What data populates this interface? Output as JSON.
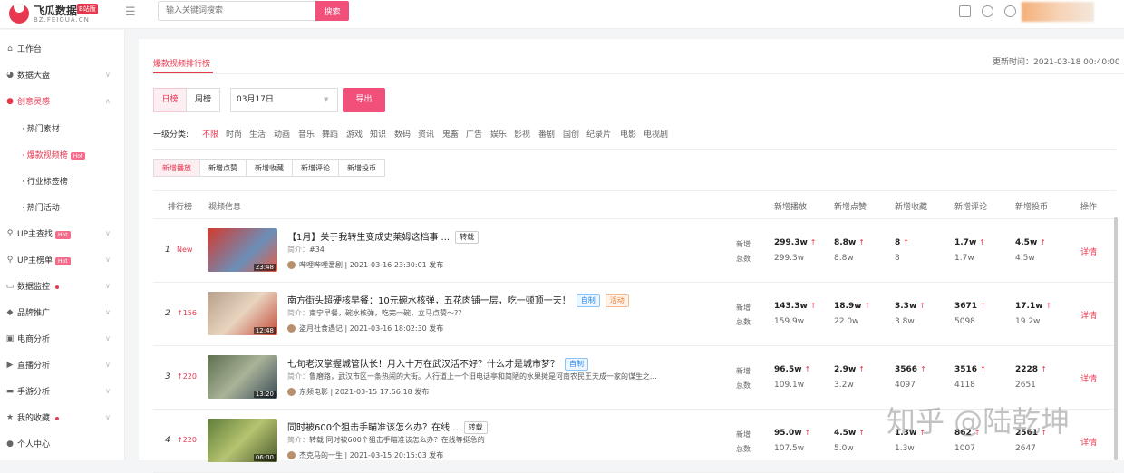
{
  "topbar": {
    "logo_name": "飞瓜数据",
    "logo_badge": "B站版",
    "logo_domain": "BZ.FEIGUA.CN",
    "search_placeholder": "输入关键词搜索",
    "search_button": "搜索"
  },
  "sidebar": {
    "items": [
      {
        "label": "工作台",
        "icon": "home-icon"
      },
      {
        "label": "数据大盘",
        "icon": "pie-chart-icon"
      },
      {
        "label": "创意灵感",
        "icon": "bulb-icon"
      },
      {
        "label": "UP主查找",
        "icon": "search-icon",
        "badge": "Hot"
      },
      {
        "label": "UP主榜单",
        "icon": "search-icon",
        "badge": "Hot"
      },
      {
        "label": "数据监控",
        "icon": "monitor-icon"
      },
      {
        "label": "品牌推广",
        "icon": "diamond-icon"
      },
      {
        "label": "电商分析",
        "icon": "shop-icon"
      },
      {
        "label": "直播分析",
        "icon": "live-icon"
      },
      {
        "label": "手游分析",
        "icon": "gamepad-icon"
      },
      {
        "label": "我的收藏",
        "icon": "star-icon"
      },
      {
        "label": "个人中心",
        "icon": "user-icon"
      }
    ],
    "sub_items": [
      {
        "label": "· 热门素材"
      },
      {
        "label": "· 爆款视频榜",
        "badge": "Hot"
      },
      {
        "label": "· 行业标签榜"
      },
      {
        "label": "· 热门活动"
      }
    ]
  },
  "main": {
    "tab": "爆款视频排行榜",
    "update_time": "更新时间：2021-03-18 00:40:00",
    "period": [
      "日榜",
      "周榜"
    ],
    "date": "03月17日",
    "export": "导出",
    "category_label": "一级分类:",
    "categories": [
      "不限",
      "时尚",
      "生活",
      "动画",
      "音乐",
      "舞蹈",
      "游戏",
      "知识",
      "数码",
      "资讯",
      "鬼畜",
      "广告",
      "娱乐",
      "影视",
      "番剧",
      "国创",
      "纪录片",
      "电影",
      "电视剧"
    ],
    "metric_tabs": [
      "新增播放",
      "新增点赞",
      "新增收藏",
      "新增评论",
      "新增投币"
    ],
    "headers": [
      "排行榜",
      "视频信息",
      "新增播放",
      "新增点赞",
      "新增收藏",
      "新增评论",
      "新增投币",
      "操作"
    ],
    "row_labels": [
      "新增",
      "总数"
    ],
    "detail": "详情"
  },
  "rows": [
    {
      "rank": "1",
      "change": "New",
      "duration": "23:48",
      "title": "【1月】关于我转生变成史莱姆这档事 ...",
      "tags": [
        {
          "text": "转载",
          "style": "plain"
        }
      ],
      "desc_key": "简介：",
      "desc": "#34",
      "uploader": "哔哩哔哩番剧",
      "date": "2021-03-16 23:30:01 发布",
      "new": [
        "299.3w",
        "8.8w",
        "8",
        "1.7w",
        "4.5w"
      ],
      "total": [
        "299.3w",
        "8.8w",
        "8",
        "1.7w",
        "4.5w"
      ]
    },
    {
      "rank": "2",
      "change": "↑156",
      "duration": "12:48",
      "title": "南方街头超硬核早餐：10元碗水核弹，五花肉铺一层，吃一顿顶一天！",
      "tags": [
        {
          "text": "自制",
          "style": "blue"
        },
        {
          "text": "活动",
          "style": "orange"
        }
      ],
      "desc_key": "简介：",
      "desc": "南宁早餐，碗水核弹，吃完一碗，立马点赞～??",
      "uploader": "盗月社食遇记",
      "date": "2021-03-16 18:02:30 发布",
      "new": [
        "143.3w",
        "18.9w",
        "3.3w",
        "3671",
        "17.1w"
      ],
      "total": [
        "159.9w",
        "22.0w",
        "3.8w",
        "5098",
        "19.2w"
      ]
    },
    {
      "rank": "3",
      "change": "↑220",
      "duration": "13:20",
      "title": "七旬老汉掌握城管队长！月入十万在武汉活不好？什么才是城市梦？",
      "tags": [
        {
          "text": "自制",
          "style": "blue"
        }
      ],
      "desc_key": "简介：",
      "desc": "鲁磨路，武汉市区一条热闹的大街。人行道上一个旧电话亭和简陋的水果摊是河南农民王天成一家的谋生之...",
      "uploader": "东频电影",
      "date": "2021-03-15 17:56:18 发布",
      "new": [
        "96.5w",
        "2.9w",
        "3566",
        "3516",
        "2228"
      ],
      "total": [
        "109.1w",
        "3.2w",
        "4097",
        "4118",
        "2651"
      ]
    },
    {
      "rank": "4",
      "change": "↑220",
      "duration": "06:00",
      "title": "同时被600个狙击手瞄准该怎么办？在线...",
      "tags": [
        {
          "text": "转载",
          "style": "plain"
        }
      ],
      "desc_key": "简介：",
      "desc": "转载 同时被600个狙击手瞄准该怎么办？在线等挺急的",
      "uploader": "杰克马的一生",
      "date": "2021-03-15 20:15:03 发布",
      "new": [
        "95.0w",
        "4.5w",
        "1.3w",
        "862",
        "2561"
      ],
      "total": [
        "107.5w",
        "5.0w",
        "1.3w",
        "1007",
        "2647"
      ]
    }
  ],
  "watermark": "知乎 @陆乾坤",
  "colors": {
    "accent": "#e8384f",
    "button": "#f0507a"
  }
}
